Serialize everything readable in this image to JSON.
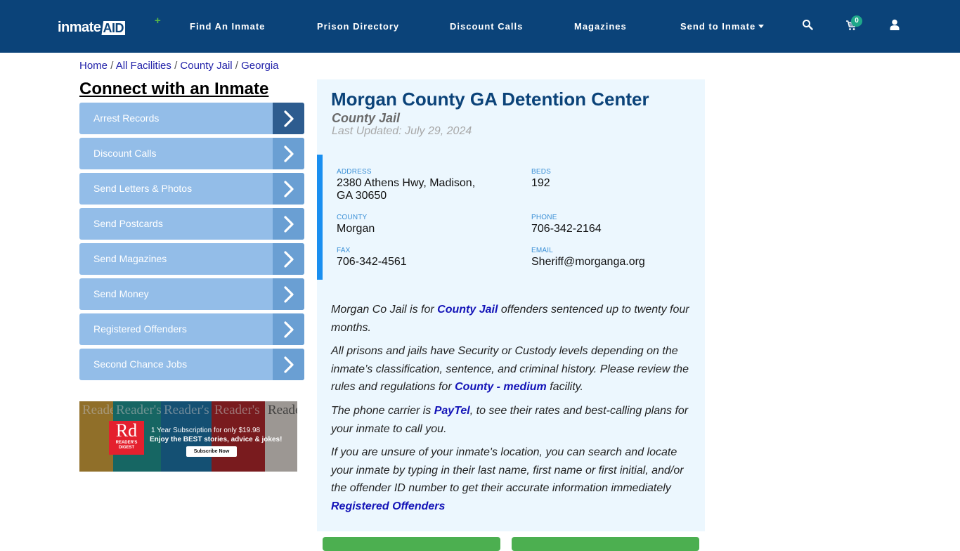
{
  "navbar": {
    "logo_left": "inmate",
    "logo_right": "AID",
    "logo_plus": "+",
    "items": [
      {
        "label": "Find An Inmate"
      },
      {
        "label": "Prison Directory"
      },
      {
        "label": "Discount Calls"
      },
      {
        "label": "Magazines"
      },
      {
        "label": "Send to Inmate",
        "dropdown": true
      }
    ],
    "icons": [
      "search-icon",
      "cart-icon",
      "user-icon"
    ],
    "cart_count": "0"
  },
  "breadcrumb": {
    "items": [
      "Home",
      "All Facilities",
      "County Jail",
      "Georgia"
    ],
    "separator": "/"
  },
  "sidebar": {
    "title": "Connect with an Inmate",
    "items": [
      {
        "label": "Arrest Records",
        "active": true
      },
      {
        "label": "Discount Calls"
      },
      {
        "label": "Send Letters & Photos"
      },
      {
        "label": "Send Postcards"
      },
      {
        "label": "Send Magazines"
      },
      {
        "label": "Send Money"
      },
      {
        "label": "Registered Offenders"
      },
      {
        "label": "Second Chance Jobs"
      }
    ],
    "ad": {
      "brand_big": "Rd",
      "brand_small_1": "READER'S",
      "brand_small_2": "DIGEST",
      "cover_title": "Reader's",
      "line1": "1 Year Subscription for only $19.98",
      "line2": "Enjoy the BEST stories, advice & jokes!",
      "cta": "Subscribe Now"
    }
  },
  "facility": {
    "name": "Morgan County GA Detention Center",
    "type": "County Jail",
    "last_updated": "Last Updated: July 29, 2024",
    "fields": {
      "address": {
        "label": "ADDRESS",
        "line1": "2380 Athens Hwy, Madison,",
        "line2": "GA 30650"
      },
      "beds": {
        "label": "BEDS",
        "value": "192"
      },
      "county": {
        "label": "COUNTY",
        "value": "Morgan"
      },
      "phone": {
        "label": "PHONE",
        "value": "706-342-2164"
      },
      "fax": {
        "label": "FAX",
        "value": "706-342-4561"
      },
      "email": {
        "label": "EMAIL",
        "value": "Sheriff@morganga.org"
      }
    },
    "paragraphs": {
      "p1_a": "Morgan Co Jail is for ",
      "p1_link": "County Jail",
      "p1_b": " offenders sentenced up to twenty four months.",
      "p2_a": "All prisons and jails have Security or Custody levels depending on the inmate’s classification, sentence, and criminal history. Please review the rules and regulations for ",
      "p2_link": "County - medium",
      "p2_b": " facility.",
      "p3_a": "The phone carrier is ",
      "p3_link": "PayTel",
      "p3_b": ", to see their rates and best-calling plans for your inmate to call you.",
      "p4_a": "If you are unsure of your inmate's location, you can search and locate your inmate by typing in their last name, first name or first initial, and/or the offender ID number to get their accurate information immediately ",
      "p4_link": "Registered Offenders"
    }
  },
  "colors": {
    "navbar_bg": "#0b4379",
    "sidebar_btn": "#93bde8",
    "sidebar_arrow": "#6a9fd3",
    "sidebar_arrow_active": "#2d5c8f",
    "card_bg": "#ecf7fe",
    "accent_bar": "#1a8ff0",
    "link": "#1414b8",
    "cart_badge": "#1fa88a",
    "green_button": "#4caf50"
  }
}
